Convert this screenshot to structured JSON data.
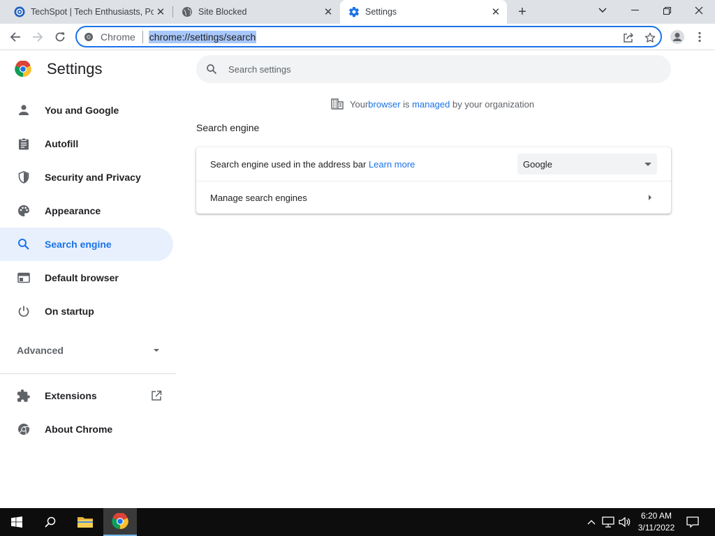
{
  "browser": {
    "tabs": [
      {
        "title": "TechSpot | Tech Enthusiasts, Pow",
        "icon": "techspot-favicon-icon",
        "active": false
      },
      {
        "title": "Site Blocked",
        "icon": "globe-icon",
        "active": false
      },
      {
        "title": "Settings",
        "icon": "settings-gear-icon",
        "active": true
      }
    ],
    "omnibox": {
      "chip_label": "Chrome",
      "url": "chrome://settings/search"
    }
  },
  "settings": {
    "title": "Settings",
    "nav": [
      {
        "label": "You and Google",
        "icon": "person-icon",
        "selected": false
      },
      {
        "label": "Autofill",
        "icon": "clipboard-icon",
        "selected": false
      },
      {
        "label": "Security and Privacy",
        "icon": "shield-icon",
        "selected": false
      },
      {
        "label": "Appearance",
        "icon": "palette-icon",
        "selected": false
      },
      {
        "label": "Search engine",
        "icon": "search-icon",
        "selected": true
      },
      {
        "label": "Default browser",
        "icon": "browser-window-icon",
        "selected": false
      },
      {
        "label": "On startup",
        "icon": "power-icon",
        "selected": false
      }
    ],
    "advanced_label": "Advanced",
    "extra_nav": [
      {
        "label": "Extensions",
        "icon": "puzzle-icon"
      },
      {
        "label": "About Chrome",
        "icon": "chrome-icon"
      }
    ],
    "search_placeholder": "Search settings",
    "managed": {
      "prefix": "Your ",
      "link1": "browser",
      "mid": " is ",
      "link2": "managed",
      "suffix": " by your organization"
    },
    "section_title": "Search engine",
    "rows": {
      "engine_label": "Search engine used in the address bar ",
      "learn_more": "Learn more",
      "engine_value": "Google",
      "manage_label": "Manage search engines"
    }
  },
  "taskbar": {
    "time": "6:20 AM",
    "date": "3/11/2022"
  },
  "colors": {
    "accent": "#1a73e8",
    "selected_bg": "#e8f0fe",
    "tabstrip": "#dee1e6"
  }
}
